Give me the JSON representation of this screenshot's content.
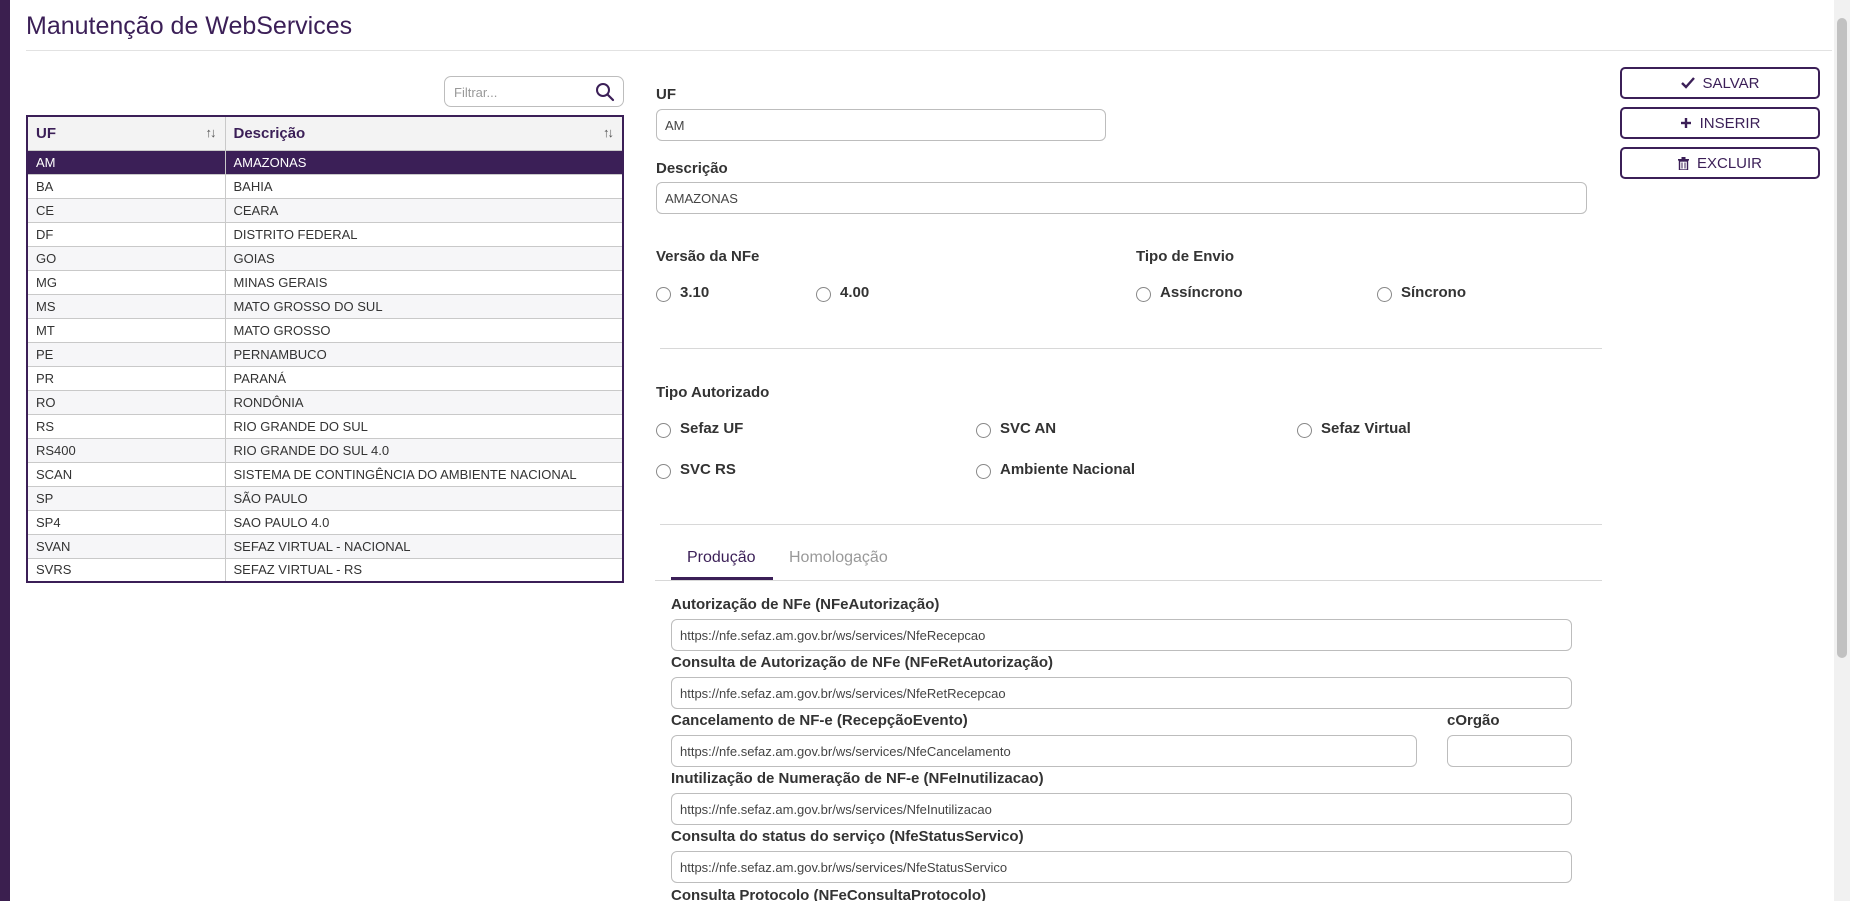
{
  "page_title": "Manutenção de WebServices",
  "filter": {
    "placeholder": "Filtrar..."
  },
  "table": {
    "headers": [
      "UF",
      "Descrição"
    ],
    "rows": [
      {
        "uf": "AM",
        "desc": "AMAZONAS"
      },
      {
        "uf": "BA",
        "desc": "BAHIA"
      },
      {
        "uf": "CE",
        "desc": "CEARA"
      },
      {
        "uf": "DF",
        "desc": "DISTRITO FEDERAL"
      },
      {
        "uf": "GO",
        "desc": "GOIAS"
      },
      {
        "uf": "MG",
        "desc": "MINAS GERAIS"
      },
      {
        "uf": "MS",
        "desc": "MATO GROSSO DO SUL"
      },
      {
        "uf": "MT",
        "desc": "MATO GROSSO"
      },
      {
        "uf": "PE",
        "desc": "PERNAMBUCO"
      },
      {
        "uf": "PR",
        "desc": "PARANÁ"
      },
      {
        "uf": "RO",
        "desc": "RONDÔNIA"
      },
      {
        "uf": "RS",
        "desc": "RIO GRANDE DO SUL"
      },
      {
        "uf": "RS400",
        "desc": "RIO GRANDE DO SUL 4.0"
      },
      {
        "uf": "SCAN",
        "desc": "SISTEMA DE CONTINGÊNCIA DO AMBIENTE NACIONAL"
      },
      {
        "uf": "SP",
        "desc": "SÃO PAULO"
      },
      {
        "uf": "SP4",
        "desc": "SAO PAULO 4.0"
      },
      {
        "uf": "SVAN",
        "desc": "SEFAZ VIRTUAL - NACIONAL"
      },
      {
        "uf": "SVRS",
        "desc": "SEFAZ VIRTUAL - RS"
      }
    ]
  },
  "form": {
    "uf_label": "UF",
    "uf_value": "AM",
    "desc_label": "Descrição",
    "desc_value": "AMAZONAS",
    "versao_label": "Versão da NFe",
    "versao_options": [
      "3.10",
      "4.00"
    ],
    "envio_label": "Tipo de Envio",
    "envio_options": [
      "Assíncrono",
      "Síncrono"
    ],
    "autorizado_label": "Tipo Autorizado",
    "autorizado_options": [
      "Sefaz UF",
      "SVC AN",
      "Sefaz Virtual",
      "SVC RS",
      "Ambiente Nacional"
    ]
  },
  "tabs": [
    "Produção",
    "Homologação"
  ],
  "services": {
    "autorizacao_label": "Autorização de NFe (NFeAutorização)",
    "autorizacao_value": "https://nfe.sefaz.am.gov.br/ws/services/NfeRecepcao",
    "ret_autorizacao_label": "Consulta de Autorização de NFe (NFeRetAutorização)",
    "ret_autorizacao_value": "https://nfe.sefaz.am.gov.br/ws/services/NfeRetRecepcao",
    "cancelamento_label": "Cancelamento de NF-e (RecepçãoEvento)",
    "cancelamento_value": "https://nfe.sefaz.am.gov.br/ws/services/NfeCancelamento",
    "corgao_label": "cOrgão",
    "corgao_value": "",
    "inutilizacao_label": "Inutilização de Numeração de NF-e (NFeInutilizacao)",
    "inutilizacao_value": "https://nfe.sefaz.am.gov.br/ws/services/NfeInutilizacao",
    "status_label": "Consulta do status do serviço (NfeStatusServico)",
    "status_value": "https://nfe.sefaz.am.gov.br/ws/services/NfeStatusServico",
    "protocolo_label": "Consulta Protocolo (NFeConsultaProtocolo)"
  },
  "actions": {
    "save": "SALVAR",
    "insert": "INSERIR",
    "delete": "EXCLUIR"
  },
  "colors": {
    "brand": "#3b1f57"
  },
  "icons": {
    "filter": "search-icon",
    "save": "check-icon",
    "insert": "plus-icon",
    "delete": "trash-icon"
  }
}
